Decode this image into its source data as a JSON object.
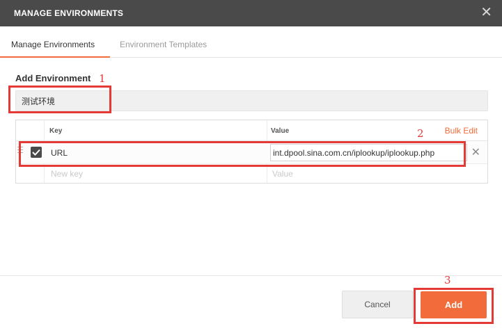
{
  "dialog": {
    "title": "MANAGE ENVIRONMENTS",
    "close_glyph": "✕"
  },
  "tabs": [
    {
      "label": "Manage Environments",
      "active": true
    },
    {
      "label": "Environment Templates",
      "active": false
    }
  ],
  "form": {
    "section_label": "Add Environment",
    "environment_name": "测试环境"
  },
  "table": {
    "headers": {
      "key": "Key",
      "value": "Value"
    },
    "bulk_edit_label": "Bulk Edit",
    "rows": [
      {
        "enabled": true,
        "key": "URL",
        "value": "int.dpool.sina.com.cn/iplookup/iplookup.php"
      }
    ],
    "new_row": {
      "key_placeholder": "New key",
      "value_placeholder": "Value"
    },
    "delete_glyph": "✕"
  },
  "footer": {
    "cancel_label": "Cancel",
    "add_label": "Add"
  },
  "annotations": [
    "1",
    "2",
    "3"
  ],
  "colors": {
    "accent": "#f26b3a",
    "titlebar": "#4a4a4a",
    "annotation": "#e53935"
  },
  "icons": [
    "close-icon",
    "drag-handle-icon",
    "checkmark-icon",
    "delete-row-icon"
  ]
}
